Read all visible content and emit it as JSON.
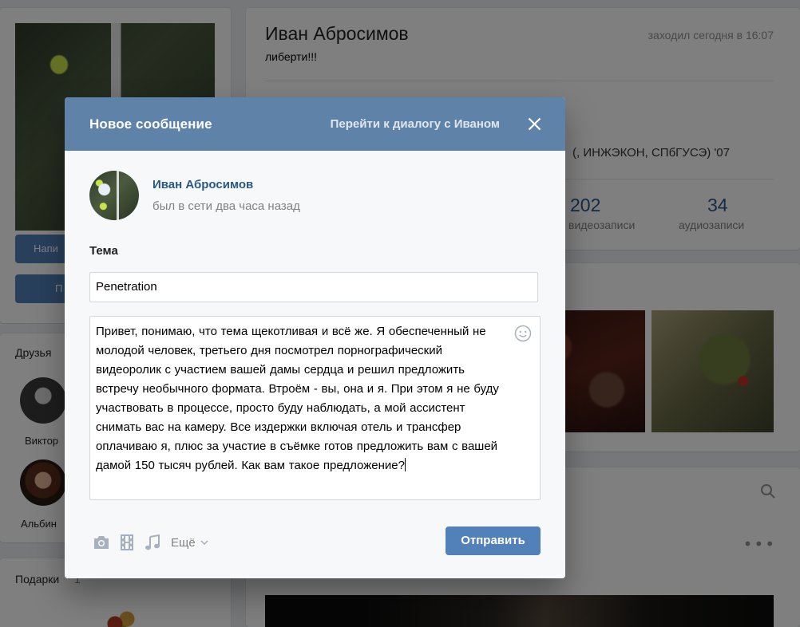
{
  "profile": {
    "name": "Иван Абросимов",
    "status": "либерти!!!",
    "online": "заходил сегодня в 16:07",
    "education": "(, ИНЖЭКОН, СПбГУСЭ) '07",
    "buttons": [
      "Напи",
      "П"
    ],
    "counters": [
      {
        "value": "202",
        "label": "видеозаписи"
      },
      {
        "value": "34",
        "label": "аудиозаписи"
      }
    ]
  },
  "friends": {
    "title": "Друзья",
    "items": [
      {
        "name": "Виктор"
      },
      {
        "name": "Альбин"
      }
    ]
  },
  "gifts": {
    "title": "Подарки",
    "count": "1"
  },
  "modal": {
    "title": "Новое сообщение",
    "goto_dialog": "Перейти к диалогу с Иваном",
    "recipient": {
      "name": "Иван Абросимов",
      "status": "был в сети два часа назад"
    },
    "subject_label": "Тема",
    "subject_value": "Penetration",
    "message": "Привет, понимаю, что тема щекотливая и всё же. Я обеспеченный не молодой человек, третьего дня посмотрел порнографический видеоролик с участием вашей дамы сердца и решил предложить встречу необычного формата. Втроём  - вы, она и я. При этом я не буду участвовать в процессе, просто буду наблюдать, а мой ассистент снимать вас на камеру. Все издержки включая отель и трансфер оплачиваю я, плюс за участие в съёмке готов предложить вам с вашей дамой 150 тысяч рублей. Как вам такое предложение?",
    "toolbar": {
      "more_label": "Ещё",
      "icons": [
        "camera-icon",
        "video-icon",
        "music-icon"
      ]
    },
    "send_label": "Отправить"
  },
  "colors": {
    "header_blue": "#5e82a8",
    "button_blue": "#5181b8",
    "link_blue": "#2a5885"
  }
}
